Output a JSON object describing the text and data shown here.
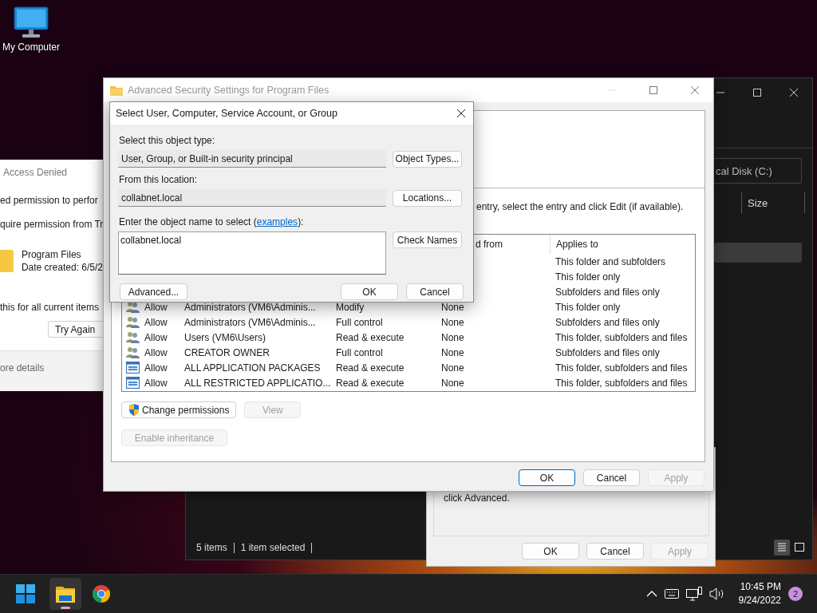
{
  "desktop": {
    "icons": [
      {
        "label": "My Computer"
      }
    ]
  },
  "explorer": {
    "address": "cal Disk (C:)",
    "column": "Size",
    "status": [
      "5 items",
      "1 item selected"
    ],
    "view_modes": [
      {
        "kind": "details",
        "selected": true
      },
      {
        "kind": "tiles",
        "selected": false
      }
    ]
  },
  "properties": {
    "note": "click Advanced.",
    "buttons": [
      {
        "label": "OK",
        "disabled": false
      },
      {
        "label": "Cancel",
        "disabled": false
      },
      {
        "label": "Apply",
        "disabled": true
      }
    ]
  },
  "access_denied": {
    "title": "Access Denied",
    "lines": [
      "ed permission to perfor",
      "quire permission from Tr"
    ],
    "file": {
      "name": "Program Files",
      "date": "Date created: 6/5/2"
    },
    "apply_all": "this for all current items",
    "button": "Try Again",
    "details": "ore details"
  },
  "advanced": {
    "title": "Advanced Security Settings for Program Files",
    "instruction": "entry, select the entry and click Edit (if available).",
    "columns": {
      "inherited": "d from",
      "applies": "Applies to"
    },
    "entries": [
      {
        "applies_to": "This folder and subfolders"
      },
      {
        "applies_to": "This folder only"
      },
      {
        "applies_to": "Subfolders and files only"
      },
      {
        "kind": "group",
        "type": "Allow",
        "principal": "Administrators (VM6\\Adminis...",
        "access": "Modify",
        "inherited": "None",
        "applies_to": "This folder only"
      },
      {
        "kind": "group",
        "type": "Allow",
        "principal": "Administrators (VM6\\Adminis...",
        "access": "Full control",
        "inherited": "None",
        "applies_to": "Subfolders and files only"
      },
      {
        "kind": "group",
        "type": "Allow",
        "principal": "Users (VM6\\Users)",
        "access": "Read & execute",
        "inherited": "None",
        "applies_to": "This folder, subfolders and files"
      },
      {
        "kind": "group",
        "type": "Allow",
        "principal": "CREATOR OWNER",
        "access": "Full control",
        "inherited": "None",
        "applies_to": "Subfolders and files only"
      },
      {
        "kind": "package",
        "type": "Allow",
        "principal": "ALL APPLICATION PACKAGES",
        "access": "Read & execute",
        "inherited": "None",
        "applies_to": "This folder, subfolders and files"
      },
      {
        "kind": "package",
        "type": "Allow",
        "principal": "ALL RESTRICTED APPLICATIO...",
        "access": "Read & execute",
        "inherited": "None",
        "applies_to": "This folder, subfolders and files"
      }
    ],
    "actions": [
      {
        "label": "Change permissions",
        "kind": "elevated",
        "disabled": false
      },
      {
        "label": "View",
        "kind": "plain",
        "disabled": true
      }
    ],
    "inheritance": {
      "label": "Enable inheritance",
      "disabled": true
    },
    "buttons": [
      {
        "label": "OK",
        "default": true,
        "disabled": false
      },
      {
        "label": "Cancel",
        "default": false,
        "disabled": false
      },
      {
        "label": "Apply",
        "default": false,
        "disabled": true
      }
    ]
  },
  "select_dialog": {
    "title": "Select User, Computer, Service Account, or Group",
    "object_type": {
      "label": "Select this object type:",
      "value": "User, Group, or Built-in security principal",
      "button": "Object Types..."
    },
    "location": {
      "label": "From this location:",
      "value": "collabnet.local",
      "button": "Locations..."
    },
    "names": {
      "label_before": "Enter the object name to select (",
      "link": "examples",
      "label_after": "):",
      "value": "collabnet.local",
      "button": "Check Names"
    },
    "buttons": [
      {
        "label": "Advanced..."
      },
      {
        "label": "OK"
      },
      {
        "label": "Cancel"
      }
    ]
  },
  "taskbar": {
    "apps": [
      {
        "kind": "start",
        "selected": false
      },
      {
        "kind": "explorer",
        "selected": true
      },
      {
        "kind": "browser",
        "selected": false
      }
    ],
    "clock": {
      "time": "10:45 PM",
      "date": "9/24/2022"
    },
    "notifications": "2"
  }
}
